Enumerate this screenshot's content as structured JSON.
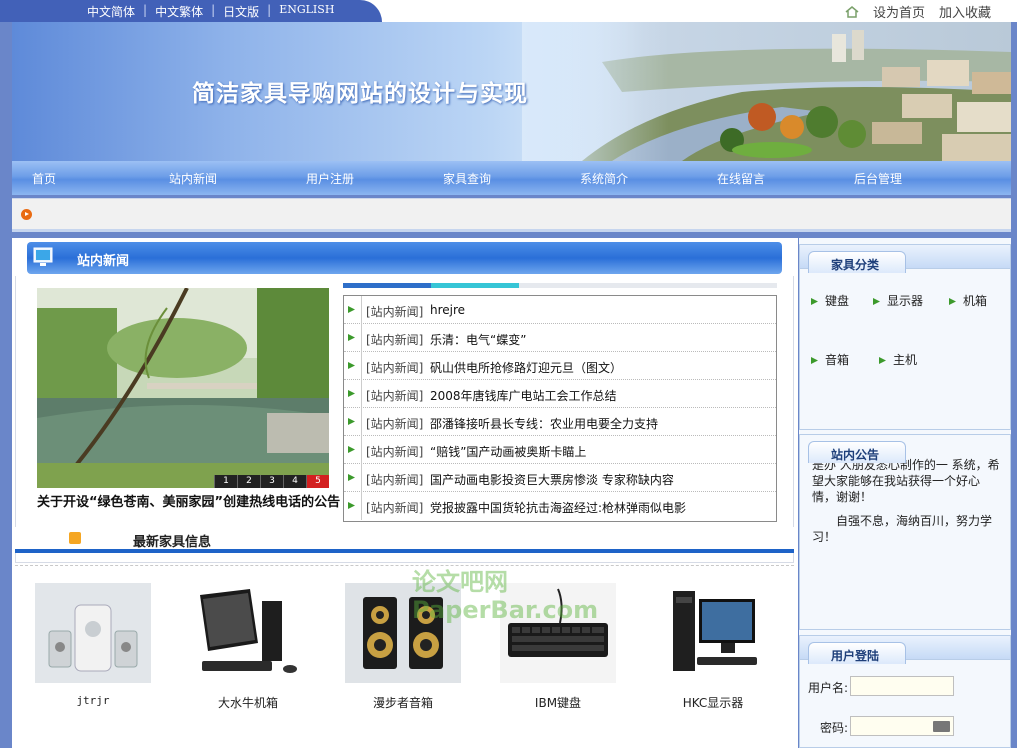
{
  "lang_links": [
    "中文简体",
    "中文繁体",
    "日文版",
    "ENGLISH"
  ],
  "top_right": {
    "set_home": "设为首页",
    "favorite": "加入收藏"
  },
  "banner": {
    "title": "简洁家具导购网站的设计与实现"
  },
  "nav": [
    "首页",
    "站内新闻",
    "用户注册",
    "家具查询",
    "系统简介",
    "在线留言",
    "后台管理"
  ],
  "news": {
    "section_title": "站内新闻",
    "photo_caption": "关于开设“绿色苍南、美丽家园”创建热线电话的公告",
    "photo_pages": [
      "1",
      "2",
      "3",
      "4",
      "5"
    ],
    "category_label": "[站内新闻]",
    "items": [
      "hrejre",
      "乐清：电气“蝶变”",
      "矾山供电所抢修路灯迎元旦（图文）",
      "2008年唐钱库广电站工会工作总结",
      "邵潘锋接听县长专线：农业用电要全力支持",
      "“赔钱”国产动画被奥斯卡瞄上",
      "国产动画电影投资巨大票房惨淡 专家称缺内容",
      "党报披露中国货轮抗击海盗经过:枪林弹雨似电影"
    ]
  },
  "latest": {
    "title": "最新家具信息",
    "products": [
      "jtrjr",
      "大水牛机箱",
      "漫步者音箱",
      "IBM键盘",
      "HKC显示器"
    ]
  },
  "sidebar": {
    "categories_title": "家具分类",
    "categories": [
      "键盘",
      "显示器",
      "机箱",
      "音箱",
      "主机"
    ],
    "notice_title": "站内公告",
    "notice_lines": [
      "是办 人朋友悉心制作的一 系统，希望大家能够在我站获得一个好心情，谢谢！",
      "自强不息，海纳百川，努力学习！"
    ],
    "login_title": "用户登陆",
    "username_label": "用户名:",
    "password_label": "密码:"
  },
  "watermark": "论文吧网 PaperBar.com",
  "colors": {
    "accent": "#1e63c8",
    "nav": "#6d9ee8",
    "lang_bar": "#4261b8"
  }
}
